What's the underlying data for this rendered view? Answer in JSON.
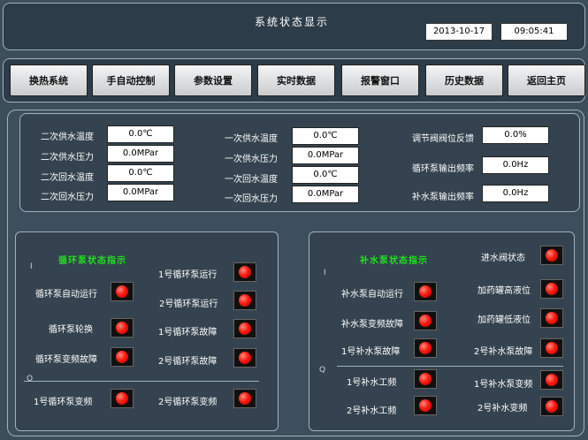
{
  "header": {
    "title": "系统状态显示",
    "date": "2013-10-17",
    "time": "09:05:41"
  },
  "nav": [
    {
      "label": "换热系统"
    },
    {
      "label": "手自动控制"
    },
    {
      "label": "参数设置"
    },
    {
      "label": "实时数据"
    },
    {
      "label": "报警窗口"
    },
    {
      "label": "历史数据"
    },
    {
      "label": "返回主页"
    }
  ],
  "params": {
    "col1": [
      {
        "label": "二次供水温度",
        "value": "0.0℃"
      },
      {
        "label": "二次供水压力",
        "value": "0.0MPar"
      },
      {
        "label": "二次回水温度",
        "value": "0.0℃"
      },
      {
        "label": "二次回水压力",
        "value": "0.0MPar"
      }
    ],
    "col2": [
      {
        "label": "一次供水温度",
        "value": "0.0℃"
      },
      {
        "label": "一次供水压力",
        "value": "0.0MPar"
      },
      {
        "label": "一次回水温度",
        "value": "0.0℃"
      },
      {
        "label": "一次回水压力",
        "value": "0.0MPar"
      }
    ],
    "col3": [
      {
        "label": "调节阀阀位反馈",
        "value": "0.0%"
      },
      {
        "label": "循环泵输出频率",
        "value": "0.0Hz"
      },
      {
        "label": "补水泵输出频率",
        "value": "0.0Hz"
      }
    ]
  },
  "circ_panel": {
    "title": "循环泵状态指示",
    "marker_i": "I",
    "marker_q": "Q",
    "indicators": [
      {
        "label": "1号循环泵运行"
      },
      {
        "label": "循环泵自动运行"
      },
      {
        "label": "2号循环泵运行"
      },
      {
        "label": "循环泵轮换"
      },
      {
        "label": "1号循环泵故障"
      },
      {
        "label": "循环泵变频故障"
      },
      {
        "label": "2号循环泵故障"
      },
      {
        "label": "1号循环泵变频"
      },
      {
        "label": "2号循环泵变频"
      }
    ]
  },
  "makeup_panel": {
    "title": "补水泵状态指示",
    "marker_i": "I",
    "marker_q": "Q",
    "indicators": [
      {
        "label": "进水阀状态"
      },
      {
        "label": "补水泵自动运行"
      },
      {
        "label": "加药罐高液位"
      },
      {
        "label": "补水泵变频故障"
      },
      {
        "label": "加药罐低液位"
      },
      {
        "label": "1号补水泵故障"
      },
      {
        "label": "2号补水泵故障"
      },
      {
        "label": "1号补水工频"
      },
      {
        "label": "1号补水泵变频"
      },
      {
        "label": "2号补水工频"
      },
      {
        "label": "2号补水变频"
      }
    ]
  },
  "colors": {
    "background": "#3c4e5a",
    "indicator_on": "#ff1a0f",
    "panel_title": "#21e01f"
  }
}
